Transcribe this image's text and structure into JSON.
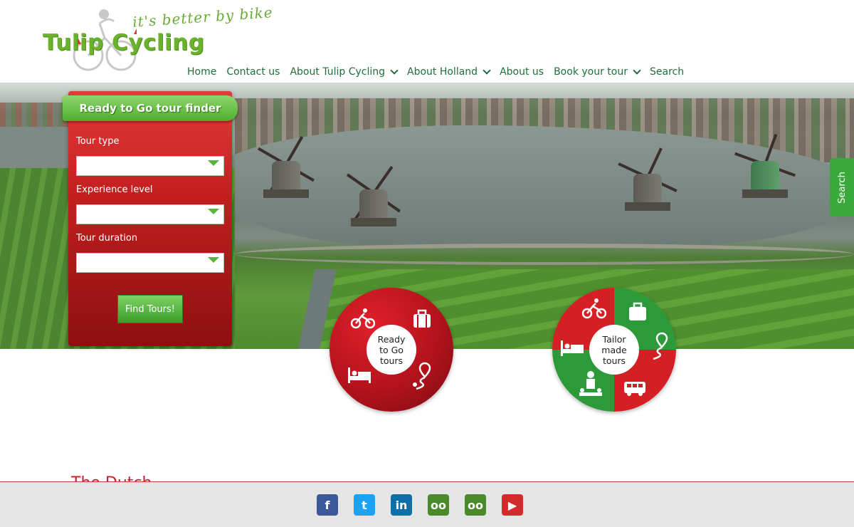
{
  "logo": {
    "brand": "Tulip Cycling",
    "tagline": "it's better by bike"
  },
  "nav": [
    {
      "label": "Home",
      "dropdown": false
    },
    {
      "label": "Contact us",
      "dropdown": false
    },
    {
      "label": "About Tulip Cycling",
      "dropdown": true
    },
    {
      "label": "About Holland",
      "dropdown": true
    },
    {
      "label": "About us",
      "dropdown": false
    },
    {
      "label": "Book your tour",
      "dropdown": true
    },
    {
      "label": "Search",
      "dropdown": false
    }
  ],
  "side_tab": {
    "label": "Search"
  },
  "finder": {
    "title": "Ready to Go tour finder",
    "fields": [
      {
        "label": "Tour type",
        "value": ""
      },
      {
        "label": "Experience level",
        "value": ""
      },
      {
        "label": "Tour duration",
        "value": ""
      }
    ],
    "button": "Find Tours!"
  },
  "circles": [
    {
      "label_lines": [
        "Ready",
        "to Go",
        "tours"
      ],
      "colors": [
        "#d11a22",
        "#8a0b12"
      ]
    },
    {
      "label_lines": [
        "Tailor",
        "made",
        "tours"
      ],
      "colors": [
        "#2d9a3a",
        "#d42024"
      ]
    }
  ],
  "heading": "The Dutch...",
  "social": [
    {
      "name": "facebook",
      "glyph": "f",
      "color": "#3b5998"
    },
    {
      "name": "twitter",
      "glyph": "t",
      "color": "#1da1f2"
    },
    {
      "name": "linkedin",
      "glyph": "in",
      "color": "#0e6ea8"
    },
    {
      "name": "tripadvisor",
      "glyph": "oo",
      "color": "#4a8a2a"
    },
    {
      "name": "tripadvisor",
      "glyph": "oo",
      "color": "#4a8a2a"
    },
    {
      "name": "youtube",
      "glyph": "▶",
      "color": "#d32b2b"
    }
  ]
}
